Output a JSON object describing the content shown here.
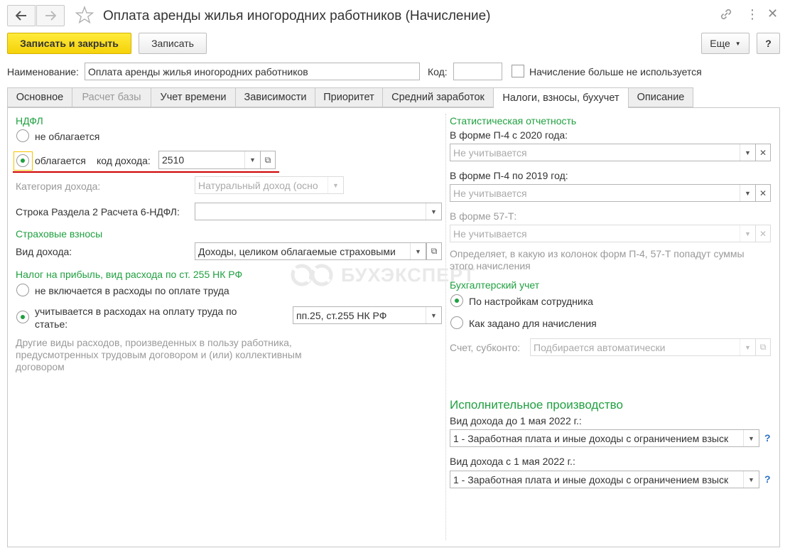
{
  "window": {
    "title": "Оплата аренды жилья иногородних работников (Начисление)"
  },
  "toolbar": {
    "save_close": "Записать и закрыть",
    "save": "Записать",
    "more": "Еще",
    "help": "?"
  },
  "header": {
    "name_label": "Наименование:",
    "name_value": "Оплата аренды жилья иногородних работников",
    "code_label": "Код:",
    "code_value": "",
    "unused_label": "Начисление больше не используется"
  },
  "tabs": [
    {
      "label": "Основное"
    },
    {
      "label": "Расчет базы"
    },
    {
      "label": "Учет времени"
    },
    {
      "label": "Зависимости"
    },
    {
      "label": "Приоритет"
    },
    {
      "label": "Средний заработок"
    },
    {
      "label": "Налоги, взносы, бухучет"
    },
    {
      "label": "Описание"
    }
  ],
  "left": {
    "ndfl_heading": "НДФЛ",
    "not_taxed": "не облагается",
    "taxed": "облагается",
    "income_code_label": "код дохода:",
    "income_code_value": "2510",
    "income_category_label": "Категория дохода:",
    "income_category_value": "Натуральный доход (осно",
    "section2_label": "Строка Раздела 2 Расчета 6-НДФЛ:",
    "section2_value": "",
    "insurance_heading": "Страховые взносы",
    "income_type_label": "Вид дохода:",
    "income_type_value": "Доходы, целиком облагаемые страховыми",
    "profit_tax_heading": "Налог на прибыль, вид расхода по ст. 255 НК РФ",
    "not_included": "не включается в расходы по оплате труда",
    "included_line1": "учитывается в расходах на оплату труда по",
    "included_line2": "статье:",
    "article_value": "пп.25, ст.255 НК РФ",
    "other_expenses_line1": "Другие виды расходов, произведенных в пользу работника,",
    "other_expenses_line2": "предусмотренных трудовым договором и (или) коллективным",
    "other_expenses_line3": "договором"
  },
  "right": {
    "stat_heading": "Статистическая отчетность",
    "p4_2020_label": "В форме П-4 с 2020 года:",
    "p4_2020_value": "Не учитывается",
    "p4_2019_label": "В форме П-4 по 2019 год:",
    "p4_2019_value": "Не учитывается",
    "f57_label": "В форме 57-Т:",
    "f57_value": "Не учитывается",
    "stat_note_line1": "Определяет, в какую из колонок форм П-4, 57-Т попадут суммы",
    "stat_note_line2": "этого начисления",
    "accounting_heading": "Бухгалтерский учет",
    "by_employee": "По настройкам сотрудника",
    "as_set": "Как задано для начисления",
    "account_label": "Счет, субконто:",
    "account_value": "Подбирается автоматически",
    "enforcement_heading": "Исполнительное производство",
    "before_may_label": "Вид дохода до 1 мая 2022 г.:",
    "before_may_value": "1 - Заработная плата и иные доходы с ограничением взыск",
    "after_may_label": "Вид дохода с 1 мая 2022 г.:",
    "after_may_value": "1 - Заработная плата и иные доходы с ограничением взыск"
  },
  "watermark": "БУХЭКСПЕРТ",
  "colors": {
    "accent_green": "#20a040",
    "primary_button": "#f5d20a",
    "highlight_underline": "#d00000"
  }
}
